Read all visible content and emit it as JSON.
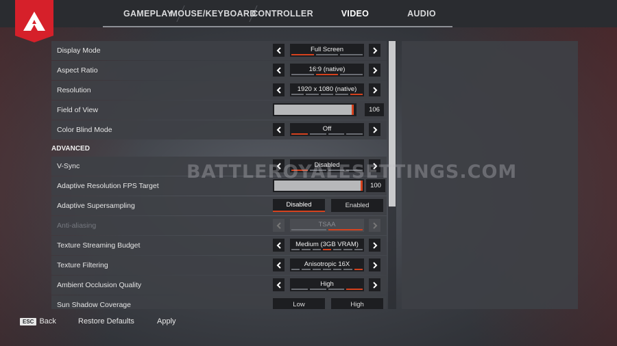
{
  "tabs": [
    {
      "label": "GAMEPLAY",
      "active": false
    },
    {
      "label": "MOUSE/KEYBOARD",
      "active": false
    },
    {
      "label": "CONTROLLER",
      "active": false
    },
    {
      "label": "VIDEO",
      "active": true
    },
    {
      "label": "AUDIO",
      "active": false
    }
  ],
  "settings": {
    "display_mode": {
      "label": "Display Mode",
      "value": "Full Screen"
    },
    "aspect_ratio": {
      "label": "Aspect Ratio",
      "value": "16:9 (native)"
    },
    "resolution": {
      "label": "Resolution",
      "value": "1920 x 1080 (native)"
    },
    "field_of_view": {
      "label": "Field of View",
      "value": "106",
      "level": 0.98
    },
    "color_blind_mode": {
      "label": "Color Blind Mode",
      "value": "Off"
    },
    "advanced_title": "ADVANCED",
    "vsync": {
      "label": "V-Sync",
      "value": "Disabled"
    },
    "adaptive_res": {
      "label": "Adaptive Resolution FPS Target",
      "value": "100",
      "level": 1.0
    },
    "adaptive_ss": {
      "label": "Adaptive Supersampling",
      "option1": "Disabled",
      "option2": "Enabled",
      "selected": "Disabled"
    },
    "anti_aliasing": {
      "label": "Anti-aliasing",
      "value": "TSAA"
    },
    "texture_budget": {
      "label": "Texture Streaming Budget",
      "value": "Medium (3GB VRAM)"
    },
    "texture_filtering": {
      "label": "Texture Filtering",
      "value": "Anisotropic 16X"
    },
    "ambient_occlusion": {
      "label": "Ambient Occlusion Quality",
      "value": "High"
    },
    "sun_shadow": {
      "label": "Sun Shadow Coverage",
      "option1": "Low",
      "option2": "High"
    }
  },
  "watermark": "BATTLEROYALESETTINGS.COM",
  "footer": {
    "esc_key": "ESC",
    "back_label": "Back",
    "restore_label": "Restore Defaults",
    "apply_label": "Apply"
  },
  "colors": {
    "accent": "#d6202a",
    "tick_active": "#d6421e"
  }
}
